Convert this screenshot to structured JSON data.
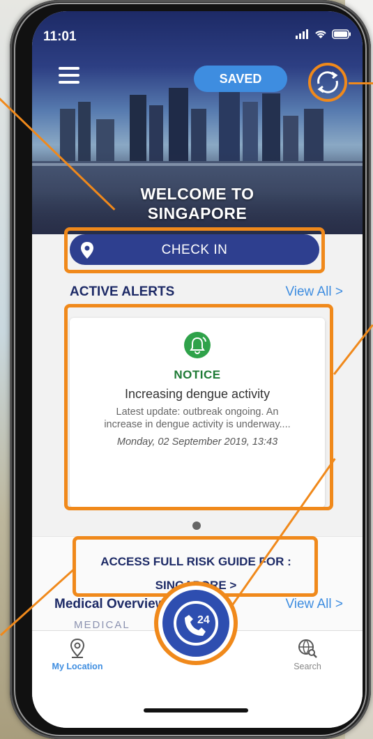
{
  "status_bar": {
    "time": "11:01"
  },
  "header": {
    "saved_label": "SAVED",
    "welcome_line1": "WELCOME TO",
    "welcome_line2": "SINGAPORE"
  },
  "checkin": {
    "label": "CHECK IN"
  },
  "alerts": {
    "heading": "ACTIVE ALERTS",
    "view_all": "View All >",
    "card": {
      "level": "NOTICE",
      "title": "Increasing dengue activity",
      "desc_line1": "Latest update: outbreak ongoing. An",
      "desc_line2": "increase in dengue activity is underway....",
      "date": "Monday, 02 September 2019, 13:43"
    }
  },
  "risk_guide": {
    "line1": "ACCESS FULL RISK GUIDE FOR :",
    "line2": "SINGAPORE >"
  },
  "medical": {
    "heading": "Medical Overview",
    "view_all": "View All >",
    "sub": "MEDICAL"
  },
  "tabs": {
    "location": "My Location",
    "search": "Search"
  },
  "colors": {
    "accent_orange": "#f0891b",
    "navy": "#2e3f8f",
    "link_blue": "#3e8de0",
    "notice_green": "#2fa24a"
  }
}
